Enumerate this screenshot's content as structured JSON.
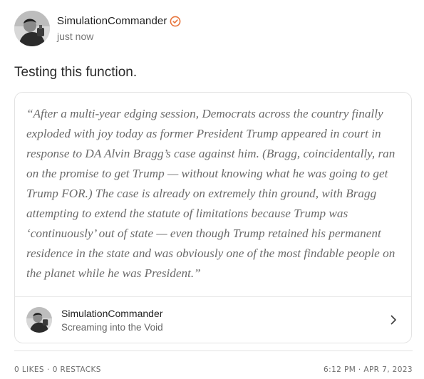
{
  "post": {
    "author": "SimulationCommander",
    "time": "just now",
    "text": "Testing this function.",
    "verified_color": "#e8743b",
    "avatar_icon": "profile-photo"
  },
  "quote": {
    "text": "“After a multi-year edging session, Democrats across the country finally exploded with joy today as former President Trump appeared in court in response to DA Alvin Bragg’s case against him. (Bragg, coincidentally, ran on the promise to get Trump — without knowing what he was going to get Trump FOR.) The case is already on extremely thin ground, with Bragg attempting to extend the statute of limitations because Trump was ‘continuously’ out of state — even though Trump retained his permanent residence in the state and was obviously one of the most findable people on the planet while he was President.”",
    "source": {
      "name": "SimulationCommander",
      "publication": "Screaming into the Void",
      "chevron_icon": "chevron-right-icon"
    }
  },
  "footer": {
    "likes": "0 LIKES",
    "separator": "·",
    "restacks": "0 RESTACKS",
    "datetime": "6:12 PM · APR 7, 2023"
  }
}
